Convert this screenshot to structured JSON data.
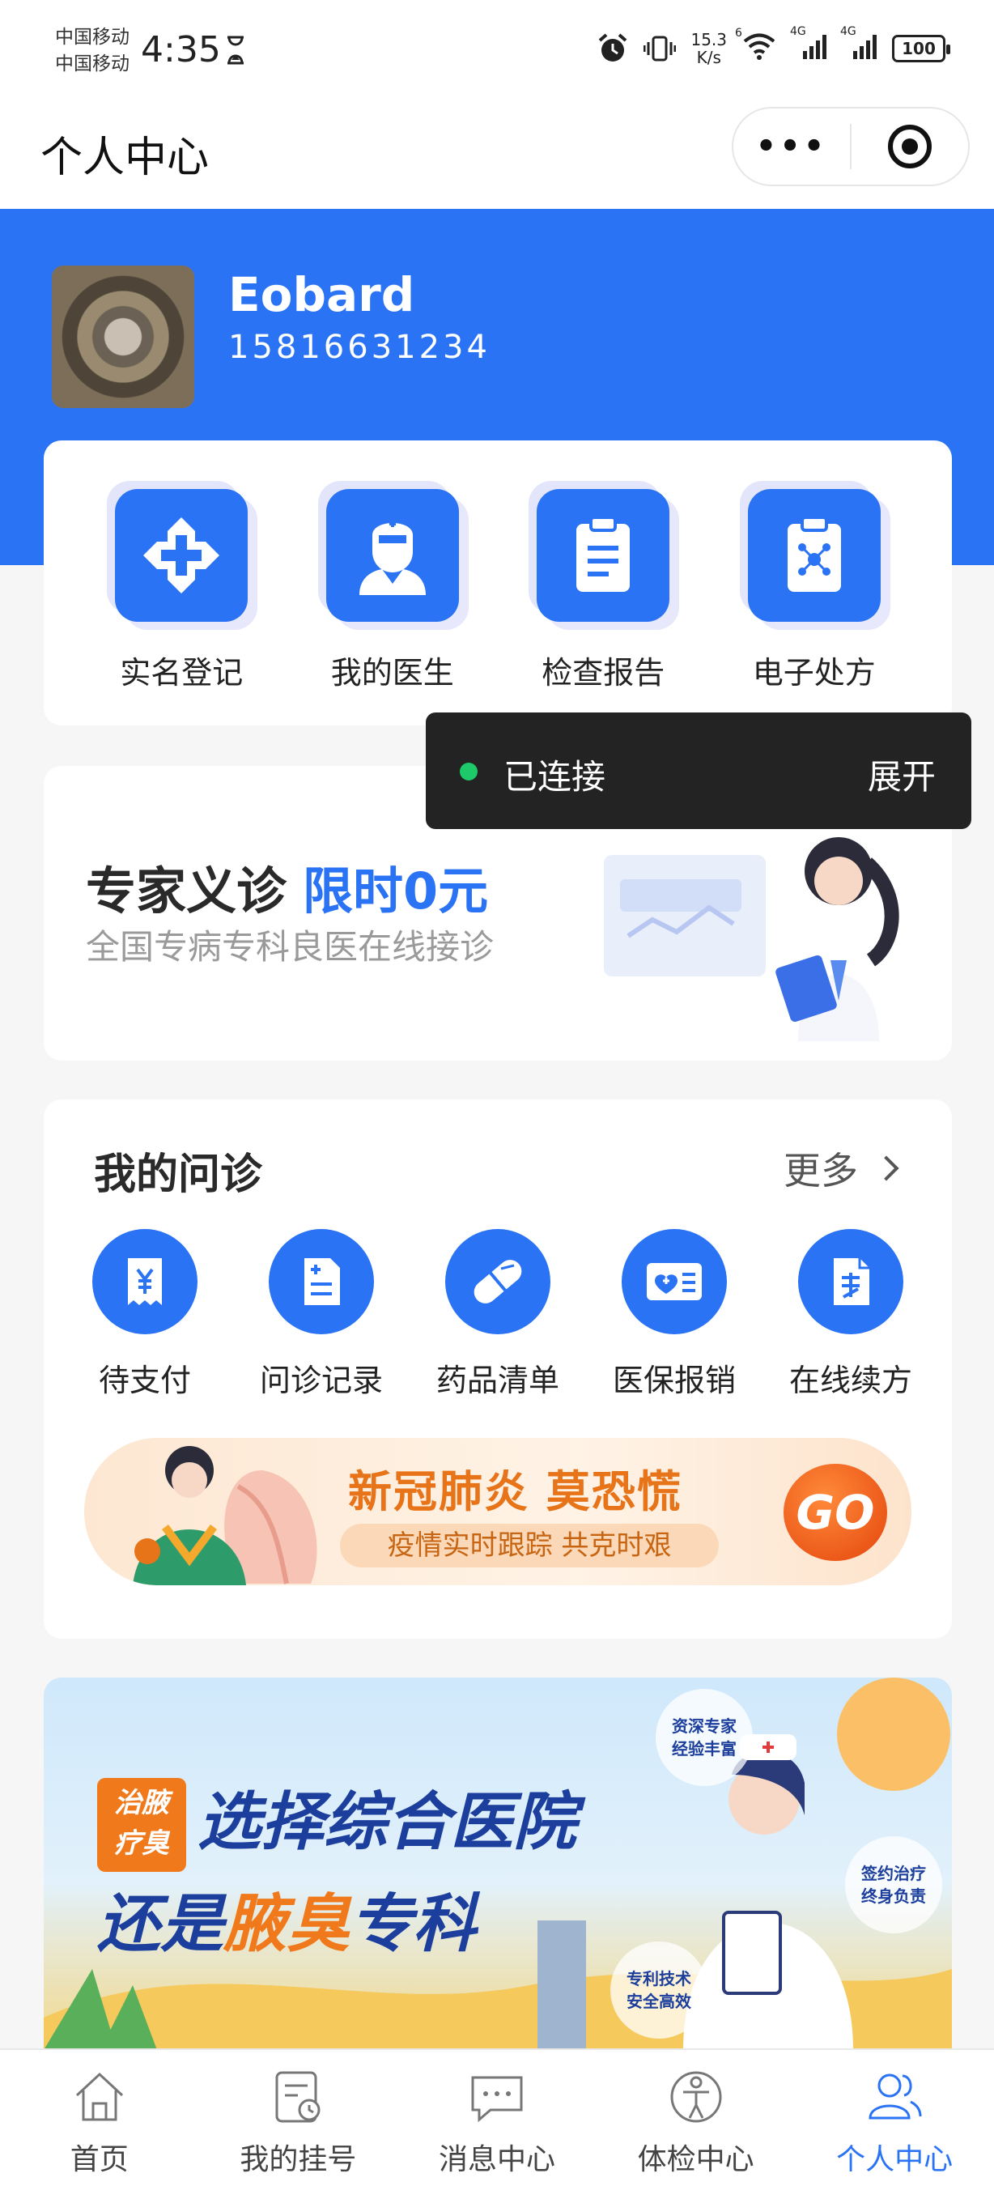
{
  "status_bar": {
    "carrier_1": "中国移动",
    "carrier_2": "中国移动",
    "time": "4:35",
    "net_speed_value": "15.3",
    "net_speed_unit": "K/s",
    "signal_1_label": "4G",
    "signal_2_label": "4G",
    "wifi_label": "6",
    "battery": "100"
  },
  "nav": {
    "title": "个人中心",
    "more_label": "•••"
  },
  "user": {
    "name": "Eobard",
    "phone": "15816631234"
  },
  "services": [
    {
      "label": "实名登记",
      "icon": "medical-cross-icon"
    },
    {
      "label": "我的医生",
      "icon": "nurse-icon"
    },
    {
      "label": "检查报告",
      "icon": "clipboard-icon"
    },
    {
      "label": "电子处方",
      "icon": "prescription-icon"
    }
  ],
  "toast": {
    "text": "已连接",
    "action": "展开"
  },
  "expert_banner": {
    "title": "专家义诊",
    "highlight": "限时0元",
    "subtitle": "全国专病专科良医在线接诊"
  },
  "consultations": {
    "title": "我的问诊",
    "more": "更多",
    "items": [
      {
        "label": "待支付",
        "icon": "yen-receipt-icon"
      },
      {
        "label": "问诊记录",
        "icon": "record-document-icon"
      },
      {
        "label": "药品清单",
        "icon": "pill-icon"
      },
      {
        "label": "医保报销",
        "icon": "medical-card-icon"
      },
      {
        "label": "在线续方",
        "icon": "renew-document-icon"
      }
    ]
  },
  "covid_banner": {
    "title": "新冠肺炎 莫恐慌",
    "subtitle": "疫情实时跟踪 共克时艰",
    "go": "GO"
  },
  "hospital_banner": {
    "tag_line1": "治腋",
    "tag_line2": "疗臭",
    "line1": "选择综合医院",
    "line2_prefix": "还是",
    "line2_accent": "腋臭",
    "line2_suffix": "专科",
    "bubble1_l1": "资深专家",
    "bubble1_l2": "经验丰富",
    "bubble2_l1": "签约治疗",
    "bubble2_l2": "终身负责",
    "bubble3_l1": "专利技术",
    "bubble3_l2": "安全高效"
  },
  "tabs": [
    {
      "label": "首页",
      "icon": "home-icon",
      "active": false
    },
    {
      "label": "我的挂号",
      "icon": "registration-icon",
      "active": false
    },
    {
      "label": "消息中心",
      "icon": "message-icon",
      "active": false
    },
    {
      "label": "体检中心",
      "icon": "body-check-icon",
      "active": false
    },
    {
      "label": "个人中心",
      "icon": "user-group-icon",
      "active": true
    }
  ],
  "colors": {
    "primary": "#2a73f4",
    "toast_bg": "#232323",
    "toast_dot": "#1ec96a",
    "covid_accent": "#e8741a"
  }
}
